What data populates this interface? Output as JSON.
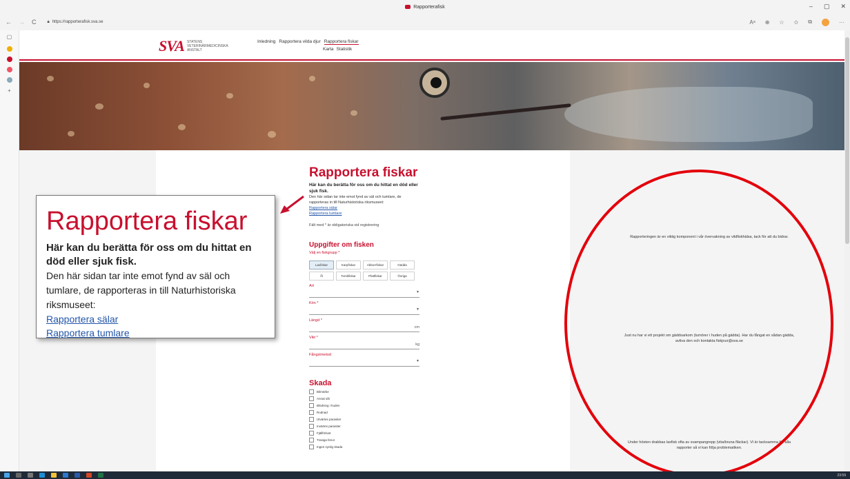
{
  "browser": {
    "tab_title": "Rapporterafisk",
    "url": "https://rapporterafisk.sva.se",
    "window_controls": [
      "–",
      "▢",
      "✕"
    ],
    "nav_icons": [
      "←",
      "→",
      "C"
    ],
    "toolbar_icons": [
      "Aᵃ",
      "⊕",
      "☆",
      "✩",
      "⧉",
      "···"
    ]
  },
  "header": {
    "logo_mark": "SVA",
    "logo_text_1": "STATENS",
    "logo_text_2": "VETERINÄRMEDICINSKA",
    "logo_text_3": "ANSTALT",
    "nav": [
      "Inledning",
      "Rapportera vilda djur",
      "Rapportera fiskar"
    ],
    "subnav": [
      "Karta",
      "Statistik"
    ]
  },
  "form": {
    "title": "Rapportera fiskar",
    "lead": "Här kan du berätta för oss om du hittat en död eller sjuk fisk.",
    "intro": "Den här sidan tar inte emot fynd av säl och tumlare, de rapporteras in till Naturhistoriska riksmuseet:",
    "link_salar": "Rapportera sälar",
    "link_tumlare": "Rapportera tumlare",
    "required_note": "Fält med * är obligatoriska vid registrering",
    "section_fish": "Uppgifter om fisken",
    "group_label": "Välj en fiskgrupp *",
    "groups": [
      "Laxfiskar",
      "Karpfiskar",
      "Abborrfiskar",
      "Gädda",
      "Ål",
      "Torskfiskar",
      "Plattfiskar",
      "Övriga"
    ],
    "fields": {
      "art": "Art",
      "kon": "Kön *",
      "langd": "Längd *",
      "langd_unit": "cm",
      "vikt": "Vikt *",
      "vikt_unit": "kg",
      "fangst": "Fångstmetod"
    },
    "section_damage": "Skada",
    "damage_options": [
      "Bitmärke",
      "Annat sår",
      "Blödning i huden",
      "Rodnad",
      "Utvärtes parasiter",
      "Invärtes parasiter",
      "Fjällförlust",
      "Trasiga fenor",
      "Ingen synlig skada"
    ]
  },
  "right_panel": {
    "msg1": "Rapporteringen är en viktig komponent i vår övervakning av vildfiskhälsa, tack för att du bidrar.",
    "msg2": "Just nu har vi ett projekt om gäddsarkom (tumörer i huden på gädda). Har du fångat en sådan gädda, avliva den och kontakta fiskjour@sva.se",
    "msg3": "Under hösten drabbas laxfisk ofta av svampangrepp (vita/bruna fläckar). Vi är tacksamma för alla rapporter så vi kan följa problematiken."
  },
  "callout": {
    "title": "Rapportera fiskar",
    "lead": "Här kan du berätta för oss om du hittat en död eller sjuk fisk.",
    "intro": "Den här sidan tar inte emot fynd av säl och tumlare, de rapporteras in till Naturhistoriska riksmuseet:",
    "link_salar": "Rapportera sälar",
    "link_tumlare": "Rapportera tumlare"
  },
  "taskbar": {
    "clock": "23:59"
  },
  "colors": {
    "brand_red": "#c8102e",
    "annotation_red": "#e3000b",
    "link_blue": "#2255aa"
  }
}
